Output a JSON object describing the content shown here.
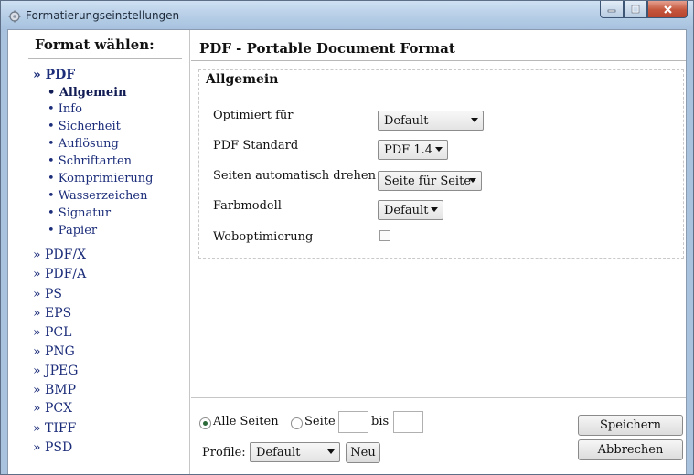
{
  "window": {
    "title": "Formatierungseinstellungen"
  },
  "sidebar": {
    "heading": "Format wählen:",
    "formats": [
      {
        "label": "» PDF",
        "active": true
      },
      {
        "label": "» PDF/X"
      },
      {
        "label": "» PDF/A"
      },
      {
        "label": "» PS"
      },
      {
        "label": "» EPS"
      },
      {
        "label": "» PCL"
      },
      {
        "label": "» PNG"
      },
      {
        "label": "» JPEG"
      },
      {
        "label": "» BMP"
      },
      {
        "label": "» PCX"
      },
      {
        "label": "» TIFF"
      },
      {
        "label": "» PSD"
      }
    ],
    "pdf_sub": [
      {
        "label": "• Allgemein",
        "active": true
      },
      {
        "label": "• Info"
      },
      {
        "label": "• Sicherheit"
      },
      {
        "label": "• Auflösung"
      },
      {
        "label": "• Schriftarten"
      },
      {
        "label": "• Komprimierung"
      },
      {
        "label": "• Wasserzeichen"
      },
      {
        "label": "• Signatur"
      },
      {
        "label": "• Papier"
      }
    ]
  },
  "main": {
    "title": "PDF - Portable Document Format",
    "section": "Allgemein",
    "fields": {
      "optimized_label": "Optimiert für",
      "optimized_value": "Default",
      "standard_label": "PDF Standard",
      "standard_value": "PDF 1.4",
      "autorotate_label": "Seiten automatisch drehen",
      "autorotate_value": "Seite für Seite",
      "colormodel_label": "Farbmodell",
      "colormodel_value": "Default",
      "weboptimize_label": "Weboptimierung",
      "weboptimize_checked": false
    }
  },
  "pages": {
    "all_label": "Alle Seiten",
    "all_selected": true,
    "page_label": "Seite",
    "page_from": "",
    "to_label": "bis",
    "page_to": ""
  },
  "profile": {
    "label": "Profile:",
    "value": "Default",
    "new_button": "Neu"
  },
  "buttons": {
    "save": "Speichern",
    "cancel": "Abbrechen"
  },
  "colors": {
    "link": "#1c2d7a",
    "frame": "#a9c3de",
    "close_button": "#c4553c"
  },
  "icons": [
    "app-icon",
    "minimize-icon",
    "maximize-icon",
    "close-icon",
    "chevron-down-icon",
    "radio-icon",
    "checkbox-icon"
  ]
}
